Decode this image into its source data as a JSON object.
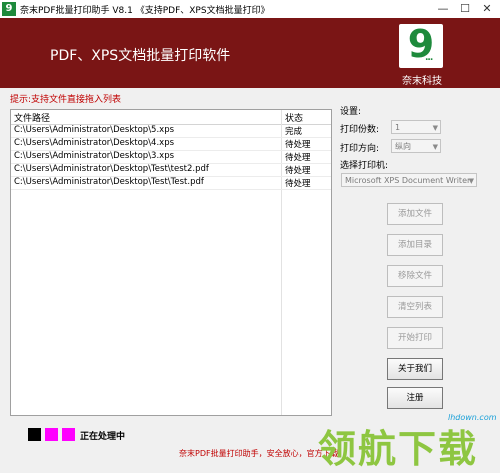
{
  "window": {
    "title": "奈末PDF批量打印助手 V8.1   《支持PDF、XPS文档批量打印》",
    "icon_glyph": "9",
    "min_glyph": "—",
    "max_glyph": "☐",
    "close_glyph": "✕"
  },
  "banner": {
    "title": "PDF、XPS文档批量打印软件",
    "logo_glyph": "9",
    "logo_dots": "...",
    "brand": "奈末科技",
    "bg_color": "#7a1515",
    "logo_color": "#1e8a3c"
  },
  "hint": "提示:支持文件直接拖入列表",
  "file_list": {
    "columns": [
      "文件路径",
      "状态"
    ],
    "rows": [
      {
        "path": "C:\\Users\\Administrator\\Desktop\\5.xps",
        "status": "完成"
      },
      {
        "path": "C:\\Users\\Administrator\\Desktop\\4.xps",
        "status": "待处理"
      },
      {
        "path": "C:\\Users\\Administrator\\Desktop\\3.xps",
        "status": "待处理"
      },
      {
        "path": "C:\\Users\\Administrator\\Desktop\\Test\\test2.pdf",
        "status": "待处理"
      },
      {
        "path": "C:\\Users\\Administrator\\Desktop\\Test\\Test.pdf",
        "status": "待处理"
      }
    ]
  },
  "settings": {
    "label": "设置:",
    "copies_label": "打印份数:",
    "copies_value": "1",
    "orientation_label": "打印方向:",
    "orientation_value": "纵向",
    "printer_label": "选择打印机:",
    "printer_value": "Microsoft XPS Document Writer"
  },
  "buttons": {
    "add_file": "添加文件",
    "add_dir": "添加目录",
    "remove_file": "移除文件",
    "clear_list": "清空列表",
    "start_print": "开始打印",
    "about": "关于我们",
    "register": "注册"
  },
  "status": {
    "processing": "正在处理中",
    "square_colors": [
      "#000000",
      "#ff00ff",
      "#ff00ff"
    ]
  },
  "footer": "奈末PDF批量打印助手，安全放心，官方下载",
  "watermark": {
    "text": "领航下载",
    "url": "lhdown.com"
  }
}
